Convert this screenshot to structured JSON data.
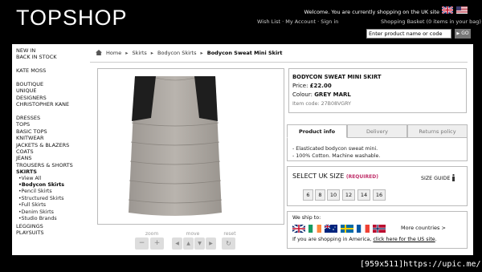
{
  "header": {
    "logo": "TOPSHOP",
    "welcome": "Welcome. You are currently shopping on the UK site",
    "account_links": [
      "Wish List",
      "My Account",
      "Sign in"
    ],
    "basket": "Shopping Basket (0 items in your bag)",
    "search_value": "Enter product name or code",
    "go_label": "GO"
  },
  "leftnav": {
    "group1": [
      "NEW IN",
      "BACK IN STOCK"
    ],
    "group2": [
      "KATE MOSS"
    ],
    "group3": [
      "BOUTIQUE",
      "UNIQUE",
      "DESIGNERS",
      "CHRISTOPHER KANE"
    ],
    "group4": [
      "DRESSES",
      "TOPS",
      "BASIC TOPS",
      "KNITWEAR",
      "JACKETS & BLAZERS",
      "COATS",
      "JEANS",
      "TROUSERS & SHORTS",
      "SKIRTS"
    ],
    "skirts_sub": [
      "View All",
      "Bodycon Skirts",
      "Pencil Skirts",
      "Structured Skirts",
      "Full Skirts",
      "Denim Skirts",
      "Studio Brands"
    ],
    "group5": [
      "LEGGINGS",
      "PLAYSUITS"
    ]
  },
  "breadcrumb": [
    "Home",
    "Skirts",
    "Bodycon Skirts",
    "Bodycon Sweat Mini Skirt"
  ],
  "viewer": {
    "zoom_label": "zoom",
    "move_label": "move",
    "reset_label": "reset"
  },
  "product": {
    "title": "BODYCON SWEAT MINI SKIRT",
    "price_label": "Price:",
    "price": "£22.00",
    "colour_label": "Colour:",
    "colour": "GREY MARL",
    "item_code": "Item code: 27B08VGRY"
  },
  "tabs": [
    "Product info",
    "Delivery",
    "Returns policy"
  ],
  "description": [
    "- Elasticated bodycon sweat mini.",
    "- 100% Cotton. Machine washable."
  ],
  "sizes": {
    "title": "SELECT UK SIZE",
    "required": "(REQUIRED)",
    "guide": "SIZE GUIDE",
    "options": [
      "6",
      "8",
      "10",
      "12",
      "14",
      "16"
    ]
  },
  "shipping": {
    "label": "We ship to:",
    "more": "More countries >",
    "america_prefix": "If you are shopping in America,",
    "america_link": "click here for the US site",
    "america_suffix": "."
  },
  "watermark": "[959x511]https://upic.me/",
  "colors": {
    "background": "#000000",
    "panel": "#ffffff",
    "accent_required": "#c0306a"
  }
}
